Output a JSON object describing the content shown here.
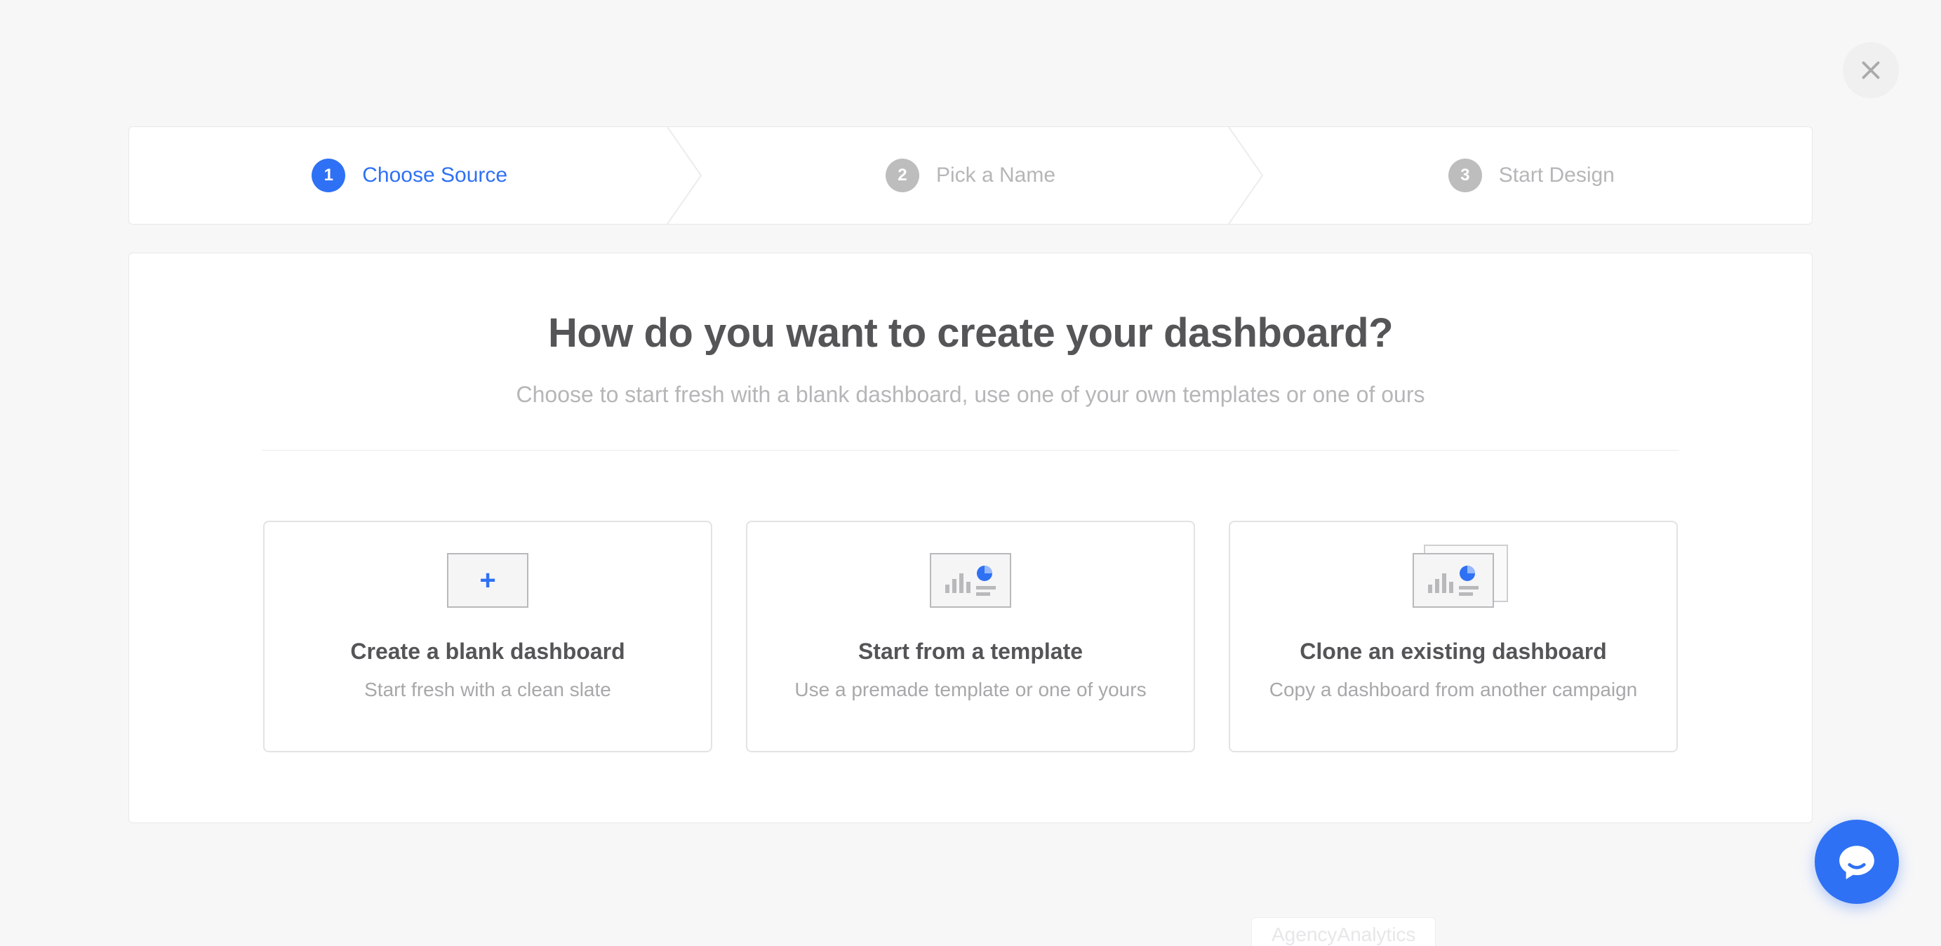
{
  "close_aria": "Close",
  "steps": [
    {
      "num": "1",
      "label": "Choose Source",
      "active": true
    },
    {
      "num": "2",
      "label": "Pick a Name",
      "active": false
    },
    {
      "num": "3",
      "label": "Start Design",
      "active": false
    }
  ],
  "panel": {
    "title": "How do you want to create your dashboard?",
    "subtitle": "Choose to start fresh with a blank dashboard, use one of your own templates or one of ours"
  },
  "options": [
    {
      "id": "blank",
      "title": "Create a blank dashboard",
      "desc": "Start fresh with a clean slate",
      "icon": "plus-icon"
    },
    {
      "id": "template",
      "title": "Start from a template",
      "desc": "Use a premade template or one of yours",
      "icon": "chart-icon"
    },
    {
      "id": "clone",
      "title": "Clone an existing dashboard",
      "desc": "Copy a dashboard from another campaign",
      "icon": "chart-stack-icon"
    }
  ],
  "ghost_label": "AgencyAnalytics",
  "chat_aria": "Open chat"
}
